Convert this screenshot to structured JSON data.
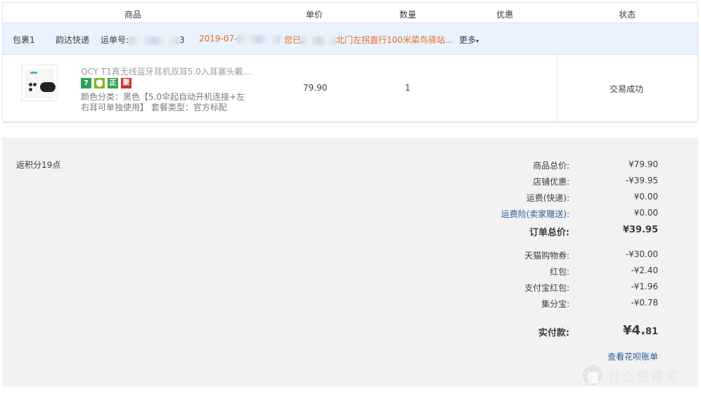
{
  "table_header": {
    "product": "商品",
    "unit_price": "单价",
    "quantity": "数量",
    "discount": "优惠",
    "status": "状态"
  },
  "package": {
    "label": "包裹1",
    "carrier": "韵达快递",
    "tracking_label": "运单号:",
    "tracking_suffix": "3",
    "date_prefix": "2019-07-",
    "message_prefix": "您已",
    "message_suffix": "北门左拐直行100米菜鸟驿站...",
    "more": "更多"
  },
  "item": {
    "title": "QCY T1真无线蓝牙耳机双耳5.0入耳塞头戴...",
    "badges": [
      {
        "text": "7",
        "color": "#29a35a"
      },
      {
        "text": "",
        "color": "#7fb80e"
      },
      {
        "text": "正",
        "color": "#3aa35b"
      },
      {
        "text": "聚",
        "color": "#c73425"
      }
    ],
    "attr_line1": "颜色分类：黑色【5.0伞起自动开机连接+左",
    "attr_line2": "右耳可单独使用】 套餐类型：官方标配",
    "price": "79.90",
    "quantity": "1",
    "status": "交易成功"
  },
  "summary": {
    "points": "返积分19点",
    "rows": [
      {
        "label": "商品总价:",
        "value": "¥79.90"
      },
      {
        "label": "店铺优惠:",
        "value": "-¥39.95"
      },
      {
        "label": "运费(快递):",
        "value": "¥0.00"
      },
      {
        "label": "运费险(卖家赠送):",
        "value": "¥0.00"
      },
      {
        "label": "订单总价:",
        "value": "¥39.95"
      },
      {
        "label": "天猫购物券:",
        "value": "-¥30.00"
      },
      {
        "label": "红包:",
        "value": "-¥2.40"
      },
      {
        "label": "支付宝红包:",
        "value": "-¥1.96"
      },
      {
        "label": "集分宝:",
        "value": "-¥0.78"
      }
    ],
    "pay_label": "实付款:",
    "pay_int": "¥4.",
    "pay_dec": "81",
    "bill_link": "查看花呗账单"
  },
  "watermark": {
    "glyph": "值",
    "text": "什么值得买"
  }
}
